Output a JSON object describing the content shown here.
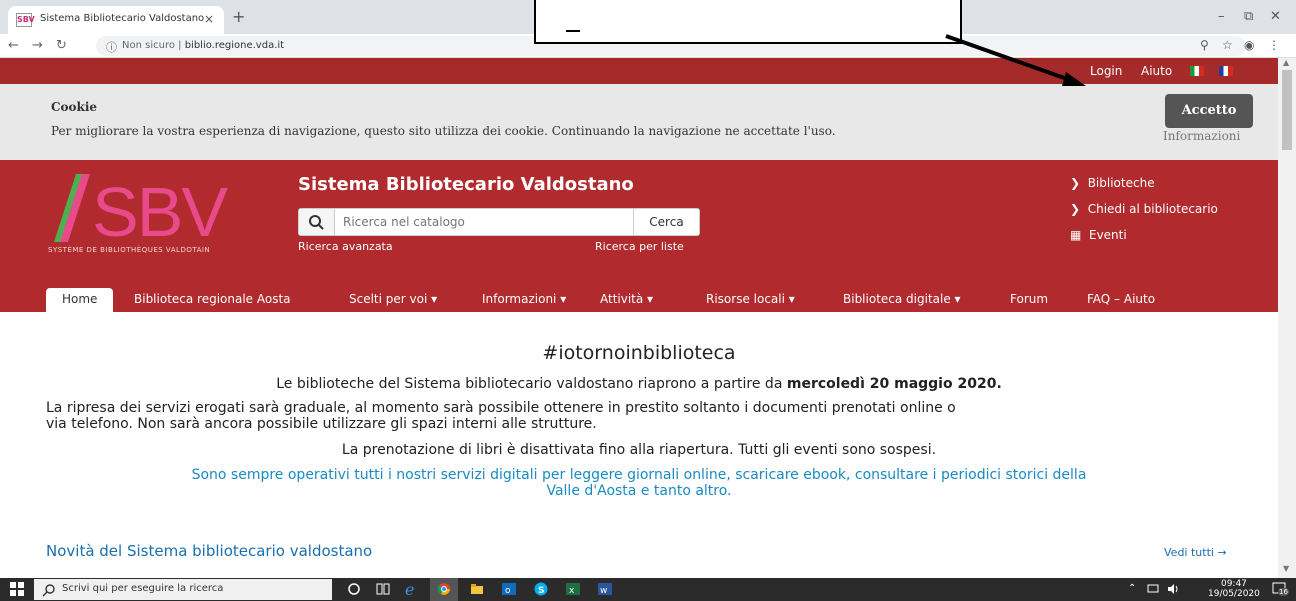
{
  "browser": {
    "tab_title": "Sistema Bibliotecario Valdostano",
    "tab_close": "×",
    "new_tab": "+",
    "url_security": "Non sicuro",
    "url_separator": "|",
    "url": "biblio.regione.vda.it",
    "favicon_text": "SBV"
  },
  "topbar": {
    "login": "Login",
    "help": "Aiuto"
  },
  "cookie": {
    "title": "Cookie",
    "text": "Per migliorare la vostra esperienza di navigazione, questo sito utilizza dei cookie. Continuando la navigazione ne accettate l'uso.",
    "accept": "Accetto",
    "info": "Informazioni"
  },
  "header": {
    "logo_letters": "SBV",
    "logo_tagline": "SYSTÈME DE BIBLIOTHÈQUES VALDOTAIN",
    "title": "Sistema Bibliotecario Valdostano",
    "search_placeholder": "Ricerca nel catalogo",
    "search_button": "Cerca",
    "advanced_search": "Ricerca avanzata",
    "list_search": "Ricerca per liste",
    "right_links": [
      "Biblioteche",
      "Chiedi al bibliotecario",
      "Eventi"
    ]
  },
  "nav": [
    "Home",
    "Biblioteca regionale Aosta",
    "Scelti per voi ▾",
    "Informazioni ▾",
    "Attività ▾",
    "Risorse locali ▾",
    "Biblioteca digitale ▾",
    "Forum",
    "FAQ – Aiuto"
  ],
  "content": {
    "heading": "#iotornoinbiblioteca",
    "line1_a": "Le biblioteche del Sistema bibliotecario valdostano riaprono a partire da ",
    "line1_b": "mercoledì 20 maggio 2020.",
    "line2": "La ripresa dei servizi erogati sarà graduale, al momento sarà possibile ottenere in prestito soltanto i documenti prenotati online o",
    "line3": "via telefono. Non sarà ancora possibile utilizzare gli spazi interni alle strutture.",
    "line4": "La prenotazione di libri è disattivata fino alla riapertura. Tutti gli eventi sono sospesi.",
    "line5": "Sono sempre operativi tutti i nostri servizi digitali per leggere giornali online, scaricare ebook, consultare i periodici storici della",
    "line6": "Valle d'Aosta e tanto altro.",
    "news_title": "Novità del Sistema bibliotecario valdostano",
    "see_all": "Vedi tutti →"
  },
  "taskbar": {
    "search_placeholder": "Scrivi qui per eseguire la ricerca",
    "time": "09:47",
    "date": "19/05/2020",
    "notif_count": "16"
  },
  "colors": {
    "brand_red": "#b02a2e",
    "topbar_red": "#a52a2a",
    "link_blue": "#1a8ac2"
  }
}
